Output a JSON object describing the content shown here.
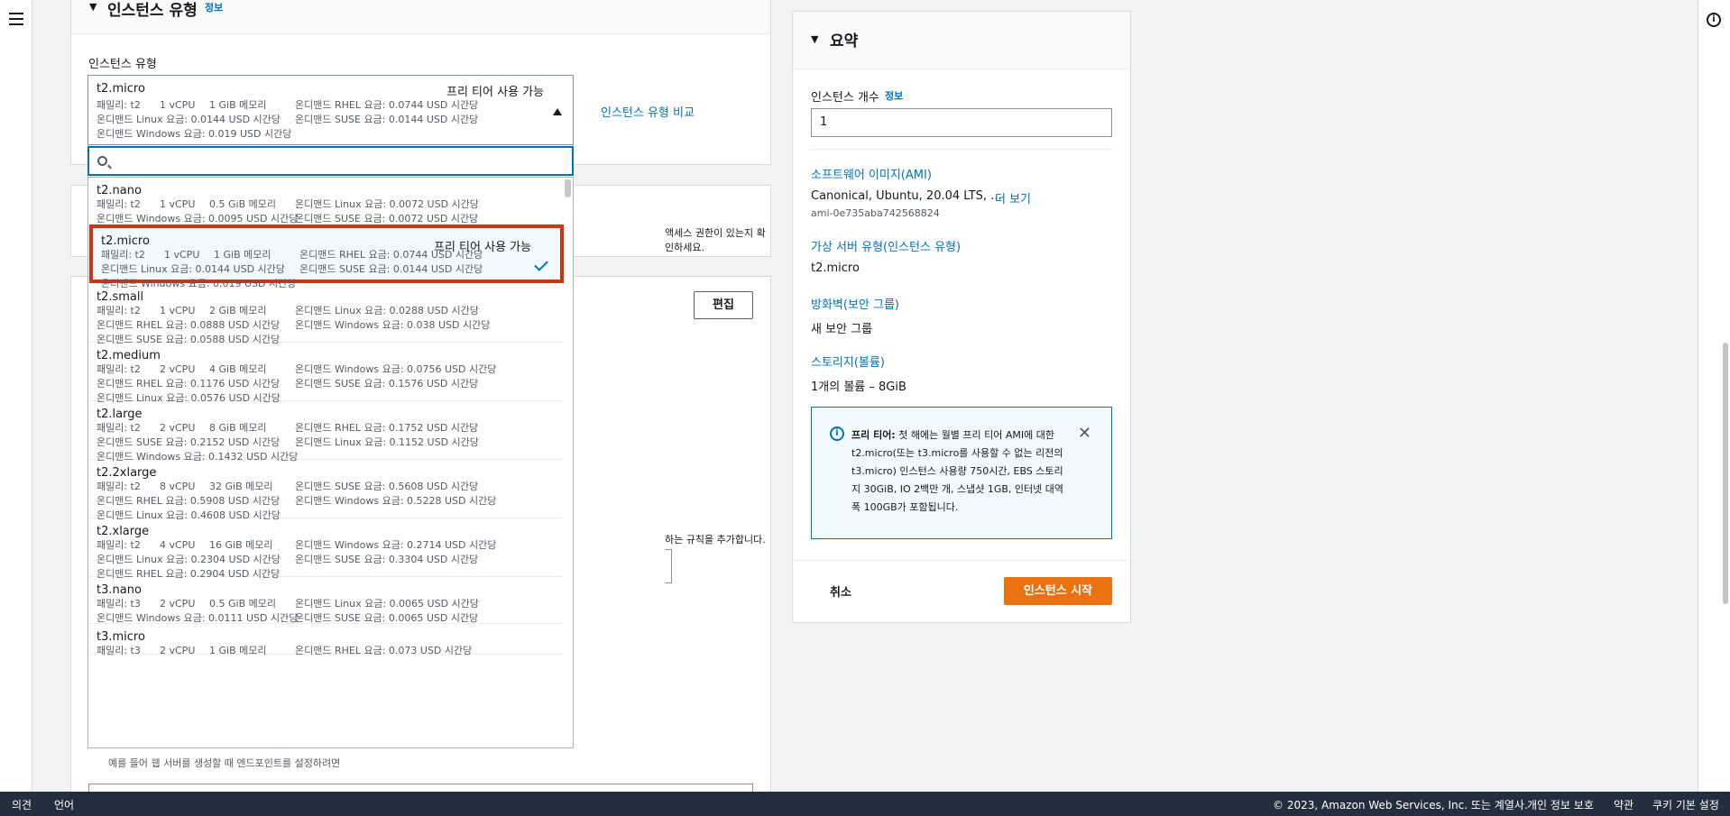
{
  "rails": {
    "menu_icon": "hamburger-icon",
    "info_icon": "info-icon"
  },
  "instance_panel": {
    "header_title": "인스턴스 유형",
    "header_info": "정보",
    "field_label": "인스턴스 유형",
    "compare_link": "인스턴스 유형 비교",
    "selected": {
      "name": "t2.micro",
      "badge": "프리 티어 사용 가능",
      "lines": [
        [
          "패밀리: t2",
          "1 vCPU",
          "1 GiB 메모리",
          "온디맨드 RHEL 요금: 0.0744 USD 시간당"
        ],
        [
          "온디맨드 Linux 요금: 0.0144 USD 시간당",
          "온디맨드 SUSE 요금: 0.0144 USD 시간당"
        ],
        [
          "온디맨드 Windows 요금: 0.019 USD 시간당"
        ]
      ]
    },
    "search_placeholder": ""
  },
  "dropdown_items": [
    {
      "name": "t2.nano",
      "badge": "",
      "lines": [
        [
          "패밀리: t2",
          "1 vCPU",
          "0.5 GiB 메모리",
          "온디맨드 Linux 요금: 0.0072 USD 시간당"
        ],
        [
          "온디맨드 Windows 요금: 0.0095 USD 시간당",
          "온디맨드 SUSE 요금: 0.0072 USD 시간당"
        ]
      ]
    },
    {
      "name": "t2.micro",
      "badge": "프리 티어 사용 가능",
      "lines": [
        [
          "패밀리: t2",
          "1 vCPU",
          "1 GiB 메모리",
          "온디맨드 RHEL 요금: 0.0744 USD 시간당"
        ],
        [
          "온디맨드 Linux 요금: 0.0144 USD 시간당",
          "온디맨드 SUSE 요금: 0.0144 USD 시간당"
        ],
        [
          "온디맨드 Windows 요금: 0.019 USD 시간당"
        ]
      ]
    },
    {
      "name": "t2.small",
      "badge": "",
      "lines": [
        [
          "패밀리: t2",
          "1 vCPU",
          "2 GiB 메모리",
          "온디맨드 Linux 요금: 0.0288 USD 시간당"
        ],
        [
          "온디맨드 RHEL 요금: 0.0888 USD 시간당",
          "온디맨드 Windows 요금: 0.038 USD 시간당"
        ],
        [
          "온디맨드 SUSE 요금: 0.0588 USD 시간당"
        ]
      ]
    },
    {
      "name": "t2.medium",
      "badge": "",
      "lines": [
        [
          "패밀리: t2",
          "2 vCPU",
          "4 GiB 메모리",
          "온디맨드 Windows 요금: 0.0756 USD 시간당"
        ],
        [
          "온디맨드 RHEL 요금: 0.1176 USD 시간당",
          "온디맨드 SUSE 요금: 0.1576 USD 시간당"
        ],
        [
          "온디맨드 Linux 요금: 0.0576 USD 시간당"
        ]
      ]
    },
    {
      "name": "t2.large",
      "badge": "",
      "lines": [
        [
          "패밀리: t2",
          "2 vCPU",
          "8 GiB 메모리",
          "온디맨드 RHEL 요금: 0.1752 USD 시간당"
        ],
        [
          "온디맨드 SUSE 요금: 0.2152 USD 시간당",
          "온디맨드 Linux 요금: 0.1152 USD 시간당"
        ],
        [
          "온디맨드 Windows 요금: 0.1432 USD 시간당"
        ]
      ]
    },
    {
      "name": "t2.2xlarge",
      "badge": "",
      "lines": [
        [
          "패밀리: t2",
          "8 vCPU",
          "32 GiB 메모리",
          "온디맨드 SUSE 요금: 0.5608 USD 시간당"
        ],
        [
          "온디맨드 RHEL 요금: 0.5908 USD 시간당",
          "온디맨드 Windows 요금: 0.5228 USD 시간당"
        ],
        [
          "온디맨드 Linux 요금: 0.4608 USD 시간당"
        ]
      ]
    },
    {
      "name": "t2.xlarge",
      "badge": "",
      "lines": [
        [
          "패밀리: t2",
          "4 vCPU",
          "16 GiB 메모리",
          "온디맨드 Windows 요금: 0.2714 USD 시간당"
        ],
        [
          "온디맨드 Linux 요금: 0.2304 USD 시간당",
          "온디맨드 SUSE 요금: 0.3304 USD 시간당"
        ],
        [
          "온디맨드 RHEL 요금: 0.2904 USD 시간당"
        ]
      ]
    },
    {
      "name": "t3.nano",
      "badge": "",
      "lines": [
        [
          "패밀리: t3",
          "2 vCPU",
          "0.5 GiB 메모리",
          "온디맨드 Linux 요금: 0.0065 USD 시간당"
        ],
        [
          "온디맨드 Windows 요금: 0.0111 USD 시간당",
          "온디맨드 SUSE 요금: 0.0065 USD 시간당"
        ]
      ]
    },
    {
      "name": "t3.micro",
      "badge": "",
      "lines": [
        [
          "패밀리: t3",
          "2 vCPU",
          "1 GiB 메모리",
          "온디맨드 RHEL 요금: 0.073 USD 시간당"
        ]
      ]
    }
  ],
  "background": {
    "key_text": "액세스 권한이 있는지 확인하세요.",
    "edit_button": "편집",
    "rule_text": "하는 규칙을 추가합니다.",
    "checkbox_hint": "예를 들어 웹 서버를 생성할 때 엔드포인트를 설정하려면"
  },
  "summary": {
    "title": "요약",
    "count_label": "인스턴스 개수",
    "count_info": "정보",
    "count_value": "1",
    "ami_label": "소프트웨어 이미지(AMI)",
    "ami_value": "Canonical, Ubuntu, 20.04 LTS, ...",
    "ami_more": "더 보기",
    "ami_id": "ami-0e735aba742568824",
    "type_label": "가상 서버 유형(인스턴스 유형)",
    "type_value": "t2.micro",
    "firewall_label": "방화벽(보안 그룹)",
    "firewall_value": "새 보안 그룹",
    "storage_label": "스토리지(볼륨)",
    "storage_value": "1개의 볼륨 – 8GiB",
    "alert_bold": "프리 티어:",
    "alert_text": " 첫 해에는 월별 프리 티어 AMI에 대한 t2.micro(또는 t3.micro를 사용할 수 없는 리전의 t3.micro) 인스턴스 사용량 750시간, EBS 스토리지 30GiB, IO 2백만 개, 스냅샷 1GB, 인터넷 대역폭 100GB가 포함됩니다.",
    "cancel": "취소",
    "launch": "인스턴스 시작"
  },
  "footer": {
    "feedback": "의견",
    "language": "언어",
    "copyright": "© 2023, Amazon Web Services, Inc. 또는 계열사.",
    "privacy": "개인 정보 보호",
    "terms": "약관",
    "cookies": "쿠키 기본 설정"
  },
  "colors": {
    "accent": "#0073bb",
    "primary_button": "#ec7211",
    "highlight_border": "#d13212",
    "footer_bg": "#232f3e"
  }
}
